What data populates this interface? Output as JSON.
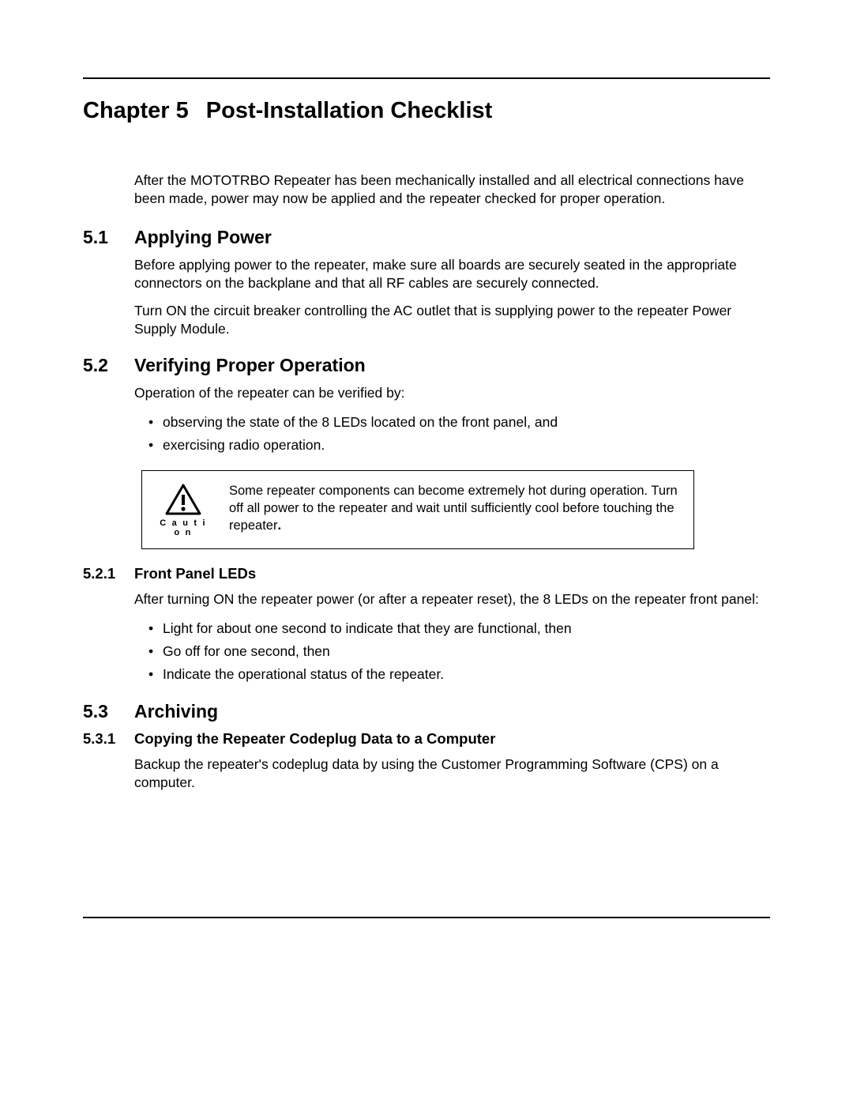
{
  "chapter": {
    "number": "Chapter 5",
    "title": "Post-Installation Checklist"
  },
  "intro": "After the MOTOTRBO Repeater has been mechanically installed and all electrical connections have been made, power may now be applied and the repeater checked for proper operation.",
  "sections": [
    {
      "num": "5.1",
      "title": "Applying Power",
      "paras": [
        "Before applying power to the repeater, make sure all boards are securely seated in the appropriate connectors on the backplane and that all RF cables are securely connected.",
        "Turn ON the circuit breaker controlling the AC outlet that is supplying power to the repeater Power Supply Module."
      ]
    },
    {
      "num": "5.2",
      "title": "Verifying Proper Operation",
      "paras": [
        "Operation of the repeater can be verified by:"
      ],
      "bullets": [
        "observing the state of the 8 LEDs located on the front panel, and",
        "exercising radio operation."
      ],
      "caution": {
        "label": "C a u t i o n",
        "text": "Some repeater components can become extremely hot during operation. Turn off all power to the repeater and wait until sufficiently cool before touching the repeater"
      },
      "subsections": [
        {
          "num": "5.2.1",
          "title": "Front Panel LEDs",
          "paras": [
            "After turning ON the repeater power (or after a repeater reset), the 8 LEDs on the repeater front panel:"
          ],
          "bullets": [
            "Light for about one second to indicate that they are functional, then",
            "Go off for one second, then",
            "Indicate the operational status of the repeater."
          ]
        }
      ]
    },
    {
      "num": "5.3",
      "title": "Archiving",
      "subsections": [
        {
          "num": "5.3.1",
          "title": "Copying the Repeater Codeplug Data to a Computer",
          "paras": [
            "Backup the repeater's codeplug data by using the Customer Programming Software (CPS) on a computer."
          ]
        }
      ]
    }
  ]
}
